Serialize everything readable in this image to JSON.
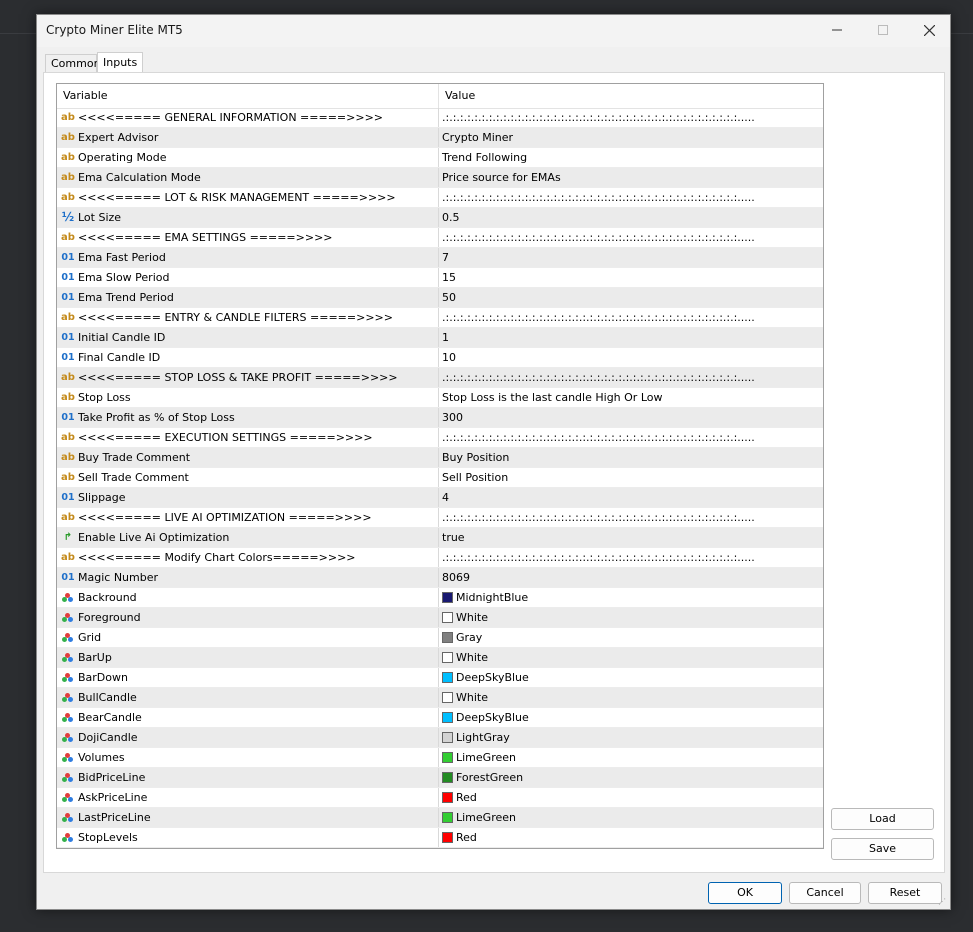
{
  "window": {
    "title": "Crypto Miner Elite MT5",
    "tabs": [
      "Common",
      "Inputs"
    ],
    "active_tab": "Inputs"
  },
  "grid": {
    "headers": {
      "variable": "Variable",
      "value": "Value"
    },
    "rows": [
      {
        "icon": "ab",
        "name": "<<<<===== GENERAL INFORMATION =====>>>>",
        "value": ".:.:.:.:.:.:.:.:.:.:.:.:.:.:.:.:.:.:.:.:.:.:.:.:.:.:.:.:.:.:.:.:.:.:.:.:.:.:.:.:.:....."
      },
      {
        "icon": "ab",
        "name": "Expert Advisor",
        "value": "Crypto Miner"
      },
      {
        "icon": "ab",
        "name": "Operating Mode",
        "value": "Trend Following"
      },
      {
        "icon": "ab",
        "name": "Ema Calculation Mode",
        "value": "Price source for EMAs"
      },
      {
        "icon": "ab",
        "name": "<<<<===== LOT & RISK MANAGEMENT =====>>>>",
        "value": ".:.:.:.:.:.:.:.:.:.:.:.:.:.:.:.:.:.:.:.:.:.:.:.:.:.:.:.:.:.:.:.:.:.:.:.:.:.:.:.:.:....."
      },
      {
        "icon": "double",
        "name": "Lot Size",
        "value": "0.5"
      },
      {
        "icon": "ab",
        "name": "<<<<===== EMA SETTINGS =====>>>>",
        "value": ".:.:.:.:.:.:.:.:.:.:.:.:.:.:.:.:.:.:.:.:.:.:.:.:.:.:.:.:.:.:.:.:.:.:.:.:.:.:.:.:.:....."
      },
      {
        "icon": "int",
        "name": "Ema Fast Period",
        "value": "7"
      },
      {
        "icon": "int",
        "name": "Ema Slow Period",
        "value": "15"
      },
      {
        "icon": "int",
        "name": "Ema Trend Period",
        "value": "50"
      },
      {
        "icon": "ab",
        "name": "<<<<===== ENTRY & CANDLE FILTERS =====>>>>",
        "value": ".:.:.:.:.:.:.:.:.:.:.:.:.:.:.:.:.:.:.:.:.:.:.:.:.:.:.:.:.:.:.:.:.:.:.:.:.:.:.:.:.:....."
      },
      {
        "icon": "int",
        "name": "Initial Candle ID",
        "value": "1"
      },
      {
        "icon": "int",
        "name": "Final Candle ID",
        "value": "10"
      },
      {
        "icon": "ab",
        "name": "<<<<===== STOP LOSS & TAKE PROFIT =====>>>>",
        "value": ".:.:.:.:.:.:.:.:.:.:.:.:.:.:.:.:.:.:.:.:.:.:.:.:.:.:.:.:.:.:.:.:.:.:.:.:.:.:.:.:.:....."
      },
      {
        "icon": "ab",
        "name": "Stop Loss",
        "value": "Stop Loss is the last candle High Or Low"
      },
      {
        "icon": "int",
        "name": "Take Profit as % of Stop Loss",
        "value": "300"
      },
      {
        "icon": "ab",
        "name": "<<<<===== EXECUTION SETTINGS =====>>>>",
        "value": ".:.:.:.:.:.:.:.:.:.:.:.:.:.:.:.:.:.:.:.:.:.:.:.:.:.:.:.:.:.:.:.:.:.:.:.:.:.:.:.:.:....."
      },
      {
        "icon": "ab",
        "name": "Buy Trade Comment",
        "value": "Buy Position"
      },
      {
        "icon": "ab",
        "name": "Sell Trade Comment",
        "value": "Sell Position"
      },
      {
        "icon": "int",
        "name": "Slippage",
        "value": "4"
      },
      {
        "icon": "ab",
        "name": "<<<<===== LIVE AI OPTIMIZATION =====>>>>",
        "value": ".:.:.:.:.:.:.:.:.:.:.:.:.:.:.:.:.:.:.:.:.:.:.:.:.:.:.:.:.:.:.:.:.:.:.:.:.:.:.:.:.:....."
      },
      {
        "icon": "bool",
        "name": "Enable Live Ai Optimization",
        "value": "true"
      },
      {
        "icon": "ab",
        "name": "<<<<===== Modify Chart Colors=====>>>>",
        "value": ".:.:.:.:.:.:.:.:.:.:.:.:.:.:.:.:.:.:.:.:.:.:.:.:.:.:.:.:.:.:.:.:.:.:.:.:.:.:.:.:.:....."
      },
      {
        "icon": "int",
        "name": "Magic Number",
        "value": "8069"
      },
      {
        "icon": "color",
        "name": "Backround",
        "value": "MidnightBlue",
        "swatch": "#191970"
      },
      {
        "icon": "color",
        "name": "Foreground",
        "value": "White",
        "swatch": "#ffffff"
      },
      {
        "icon": "color",
        "name": "Grid",
        "value": "Gray",
        "swatch": "#808080"
      },
      {
        "icon": "color",
        "name": "BarUp",
        "value": "White",
        "swatch": "#ffffff"
      },
      {
        "icon": "color",
        "name": "BarDown",
        "value": "DeepSkyBlue",
        "swatch": "#00bfff"
      },
      {
        "icon": "color",
        "name": "BullCandle",
        "value": "White",
        "swatch": "#ffffff"
      },
      {
        "icon": "color",
        "name": "BearCandle",
        "value": "DeepSkyBlue",
        "swatch": "#00bfff"
      },
      {
        "icon": "color",
        "name": "DojiCandle",
        "value": "LightGray",
        "swatch": "#d3d3d3"
      },
      {
        "icon": "color",
        "name": "Volumes",
        "value": "LimeGreen",
        "swatch": "#32cd32"
      },
      {
        "icon": "color",
        "name": "BidPriceLine",
        "value": "ForestGreen",
        "swatch": "#228b22"
      },
      {
        "icon": "color",
        "name": "AskPriceLine",
        "value": "Red",
        "swatch": "#ff0000"
      },
      {
        "icon": "color",
        "name": "LastPriceLine",
        "value": "LimeGreen",
        "swatch": "#32cd32"
      },
      {
        "icon": "color",
        "name": "StopLevels",
        "value": "Red",
        "swatch": "#ff0000"
      }
    ]
  },
  "buttons": {
    "load": "Load",
    "save": "Save",
    "ok": "OK",
    "cancel": "Cancel",
    "reset": "Reset"
  },
  "icons": {
    "ab": "ab",
    "int": "01",
    "double": "½",
    "bool": "↱"
  }
}
